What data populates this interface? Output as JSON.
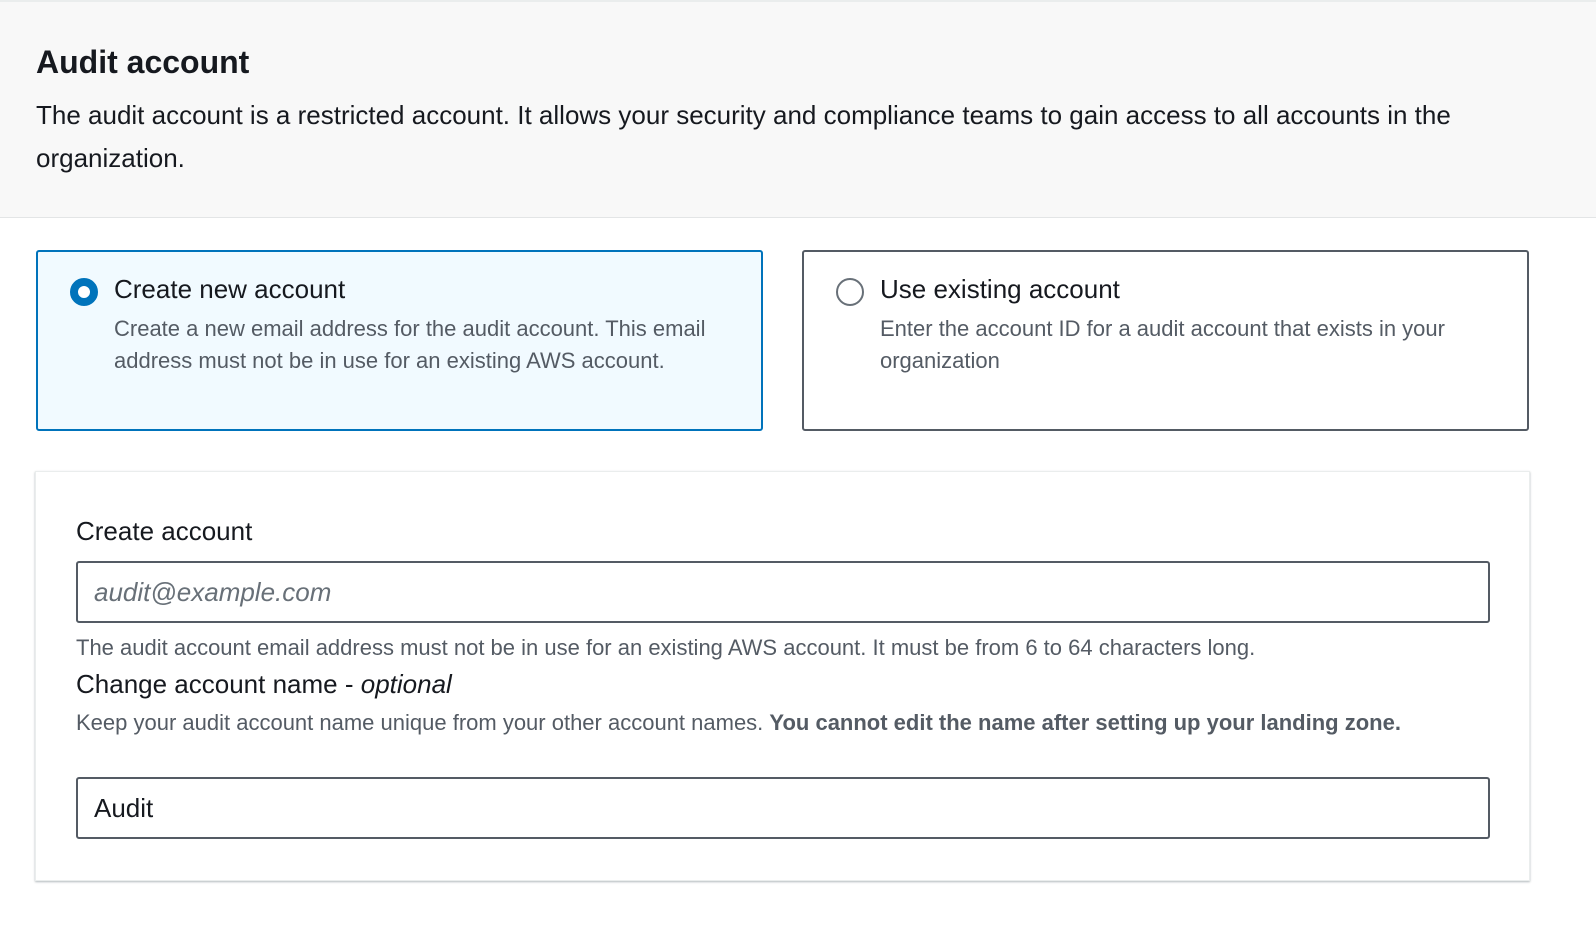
{
  "header": {
    "title": "Audit account",
    "description": "The audit account is a restricted account. It allows your security and compliance teams to gain access to all accounts in the organization."
  },
  "options": [
    {
      "label": "Create new account",
      "description": "Create a new email address for the audit account. This email address must not be in use for an existing AWS account.",
      "selected": true
    },
    {
      "label": "Use existing account",
      "description": "Enter the account ID for a audit account that exists in your organization",
      "selected": false
    }
  ],
  "form": {
    "email_label": "Create account",
    "email_placeholder": "audit@example.com",
    "email_value": "",
    "email_help": "The audit account email address must not be in use for an existing AWS account. It must be from 6 to 64 characters long.",
    "name_label": "Change account name - ",
    "name_label_optional": "optional",
    "name_help": "Keep your audit account name unique from your other account names. ",
    "name_help_bold": "You cannot edit the name after setting up your landing zone.",
    "name_value": "Audit"
  },
  "colors": {
    "accent": "#0073bb",
    "selected_bg": "#f1faff"
  }
}
